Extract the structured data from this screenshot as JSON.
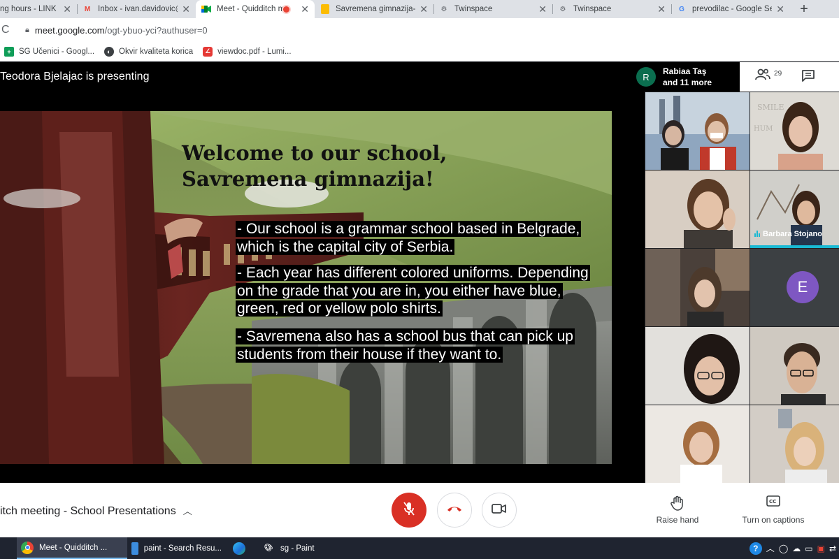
{
  "browser": {
    "tabs": [
      {
        "title": "ng hours - LINK g",
        "icon": "page-icon"
      },
      {
        "title": "Inbox - ivan.davidovic@",
        "icon": "gmail-icon"
      },
      {
        "title": "Meet - Quidditch m",
        "icon": "meet-icon",
        "active": true,
        "recording": true
      },
      {
        "title": "Savremena gimnazija- H",
        "icon": "slides-icon"
      },
      {
        "title": "Twinspace",
        "icon": "twinspace-icon"
      },
      {
        "title": "Twinspace",
        "icon": "twinspace-icon"
      },
      {
        "title": "prevodilac - Google Sea",
        "icon": "google-icon"
      }
    ],
    "new_tab": "+",
    "url_host": "meet.google.com",
    "url_path": "/ogt-ybuo-yci?authuser=0",
    "bookmarks": [
      {
        "label": "SG Učenici - Googl...",
        "icon": "sheets-icon"
      },
      {
        "label": "Okvir kvaliteta korica",
        "icon": "globe-icon"
      },
      {
        "label": "viewdoc.pdf - Lumi...",
        "icon": "pdf-icon"
      }
    ]
  },
  "meet": {
    "presenting_text": "Teodora Bjelajac is presenting",
    "people_summary": {
      "avatar_initial": "R",
      "line1": "Rabiaa Taş",
      "line2": "and 11 more",
      "participant_count": "29"
    },
    "slide": {
      "title": "Welcome to our school, Savremena gimnazija!",
      "bullets": [
        "- Our school is a grammar school based in Belgrade, which is the capital city of Serbia.",
        "- Each year has different colored uniforms. Depending on the grade that you are in, you either have blue, green, red or yellow polo shirts.",
        "- Savremena also has a school bus that can pick up students from their house if they want to."
      ]
    },
    "tiles": {
      "speaking_name": "Barbara Stojano",
      "avatar_initial": "E",
      "avatar_color": "#7e57c2"
    },
    "meeting_title": "itch meeting - School Presentations",
    "raise_hand": "Raise hand",
    "captions": "Turn on captions",
    "accent_red": "#d93025"
  },
  "taskbar": {
    "items": [
      {
        "label": "Meet - Quidditch ...",
        "icon": "chrome-icon",
        "active": true
      },
      {
        "label": "paint - Search Resu...",
        "icon": "file-icon"
      },
      {
        "label": "",
        "icon": "edge-icon"
      },
      {
        "label": "sg - Paint",
        "icon": "paint-icon"
      }
    ]
  }
}
